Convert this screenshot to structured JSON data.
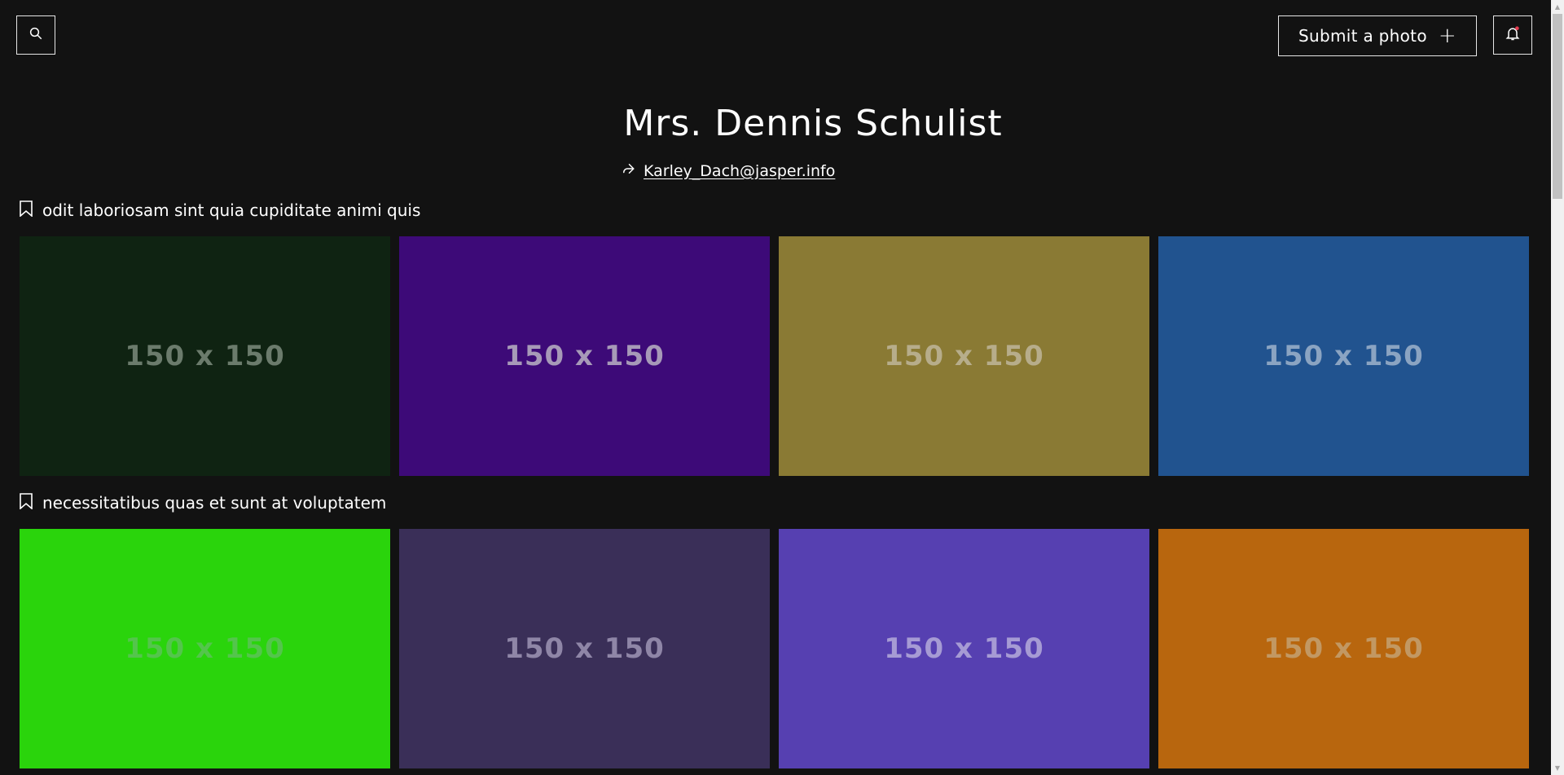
{
  "header": {
    "search_icon": "search-icon",
    "submit_label": "Submit a photo",
    "submit_icon": "+",
    "bell_icon": "bell-icon",
    "notification_dot_color": "#e23b4f"
  },
  "profile": {
    "name": "Mrs. Dennis Schulist",
    "link_icon": "share-arrow-icon",
    "email": "Karley_Dach@jasper.info"
  },
  "collections": [
    {
      "title": "odit laboriosam sint quia cupiditate animi quis",
      "photos": [
        {
          "label": "150 x 150",
          "bg": "#0f2312",
          "fg": "#6b7b6c"
        },
        {
          "label": "150 x 150",
          "bg": "#3d0a78",
          "fg": "#a79ab8"
        },
        {
          "label": "150 x 150",
          "bg": "#8a7a34",
          "fg": "#b7ad8b"
        },
        {
          "label": "150 x 150",
          "bg": "#21538f",
          "fg": "#8ba4c2"
        }
      ]
    },
    {
      "title": "necessitatibus quas et sunt at voluptatem",
      "photos": [
        {
          "label": "150 x 150",
          "bg": "#2ad40c",
          "fg": "#54c54c"
        },
        {
          "label": "150 x 150",
          "bg": "#3a2f58",
          "fg": "#8f86a7"
        },
        {
          "label": "150 x 150",
          "bg": "#5640b1",
          "fg": "#a69bd4"
        },
        {
          "label": "150 x 150",
          "bg": "#b8660e",
          "fg": "#c29863"
        }
      ]
    }
  ]
}
